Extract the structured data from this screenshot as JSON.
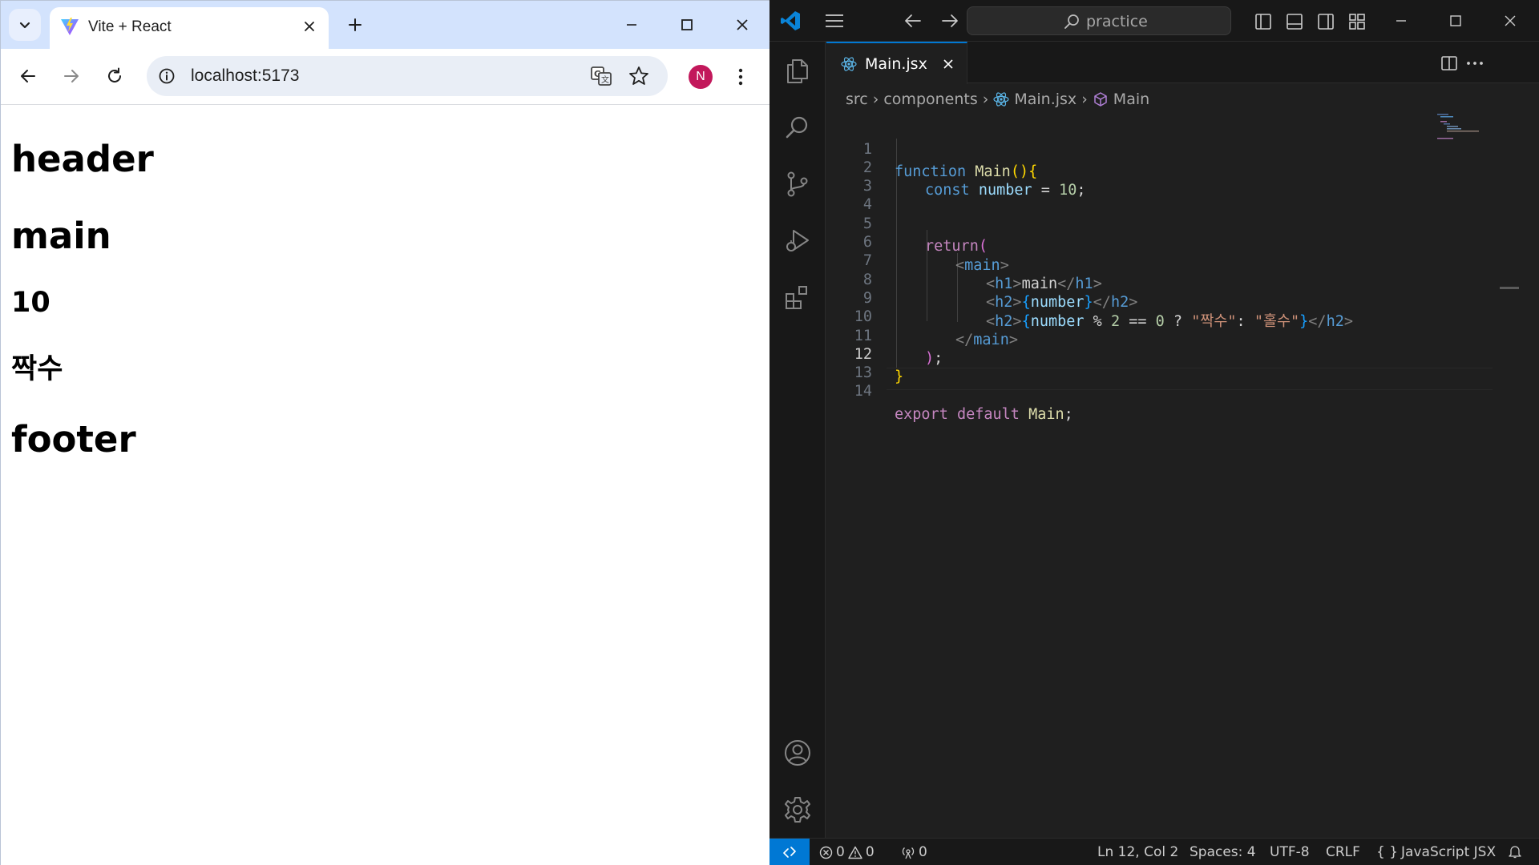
{
  "browser": {
    "tab_title": "Vite + React",
    "url": "localhost:5173",
    "profile_initial": "N",
    "page": {
      "h1_header": "header",
      "h1_main": "main",
      "h2_number": "10",
      "h2_parity": "짝수",
      "h1_footer": "footer"
    }
  },
  "vscode": {
    "command_center": "practice",
    "tab_name": "Main.jsx",
    "breadcrumb": [
      "src",
      "components",
      "Main.jsx",
      "Main"
    ],
    "line_numbers": [
      "1",
      "2",
      "3",
      "4",
      "5",
      "6",
      "7",
      "8",
      "9",
      "10",
      "11",
      "12",
      "13",
      "14"
    ],
    "active_line": "12",
    "code": {
      "l1_kw": "function",
      "l1_name": "Main",
      "l1_paren": "()",
      "l1_brace": "{",
      "l2_kw": "const",
      "l2_var": "number",
      "l2_eq": " = ",
      "l2_num": "10",
      "l2_semi": ";",
      "l5_kw": "return",
      "l5_paren": "(",
      "l6_open": "<",
      "l6_tag": "main",
      "l6_close": ">",
      "l7_h1": "h1",
      "l7_text": "main",
      "l8_h2": "h2",
      "l8_var": "number",
      "l9_var": "number",
      "l9_op": " % ",
      "l9_num2": "2",
      "l9_eq": " == ",
      "l9_num0": "0",
      "l9_q": " ? ",
      "l9_str1": "\"짝수\"",
      "l9_colon": ": ",
      "l9_str2": "\"홀수\"",
      "l10_tag": "main",
      "l11_paren": ")",
      "l11_semi": ";",
      "l12_brace": "}",
      "l14_export": "export",
      "l14_default": "default",
      "l14_name": "Main",
      "l14_semi": ";"
    },
    "status": {
      "errors": "0",
      "warnings": "0",
      "ports": "0",
      "cursor": "Ln 12, Col 2",
      "spaces": "Spaces: 4",
      "encoding": "UTF-8",
      "eol": "CRLF",
      "language": "JavaScript JSX"
    }
  },
  "colors": {
    "accent": "#0078d4",
    "chrome_tabbar": "#d3e3fd",
    "profile": "#c2185b",
    "editor_bg": "#1f1f1f"
  }
}
